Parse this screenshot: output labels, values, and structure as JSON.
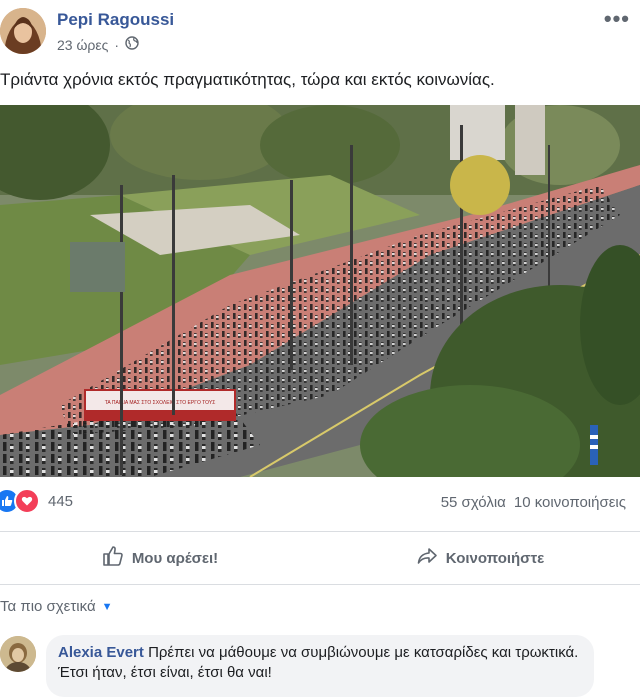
{
  "post": {
    "author": "Pepi Ragoussi",
    "time": "23 ώρες",
    "separator": "·",
    "text": "Τριάντα χρόνια εκτός πραγματικότητας, τώρα και εκτός κοινωνίας.",
    "more_label": "•••"
  },
  "banner": {
    "text": "ΤΑ ΠΑΙΔΙΑ ΜΑΣ ΣΤΟ ΣΧΟΛΕΙΟ ΣΤΟ ΕΡΓΟ ΤΟΥΣ"
  },
  "stats": {
    "reactions_count": "445",
    "comments": "55 σχόλια",
    "shares": "10 κοινοποιήσεις"
  },
  "actions": {
    "like_label": "Μου αρέσει!",
    "share_label": "Κοινοποιήστε"
  },
  "comments": {
    "sort_label": "Τα πιο σχετικά",
    "items": [
      {
        "author": "Alexia Evert",
        "text": "Πρέπει να μάθουμε να συμβιώνουμε με κατσαρίδες και τρωκτικά. Έτσι ήταν, έτσι είναι, έτσι θα ναι!"
      }
    ]
  },
  "colors": {
    "link": "#385898",
    "like": "#1877f2",
    "love": "#f33e58",
    "muted": "#606770"
  },
  "icons": [
    "globe-icon",
    "more-icon",
    "like-reaction-icon",
    "love-reaction-icon",
    "thumbs-up-icon",
    "share-arrow-icon",
    "chevron-down-icon"
  ]
}
